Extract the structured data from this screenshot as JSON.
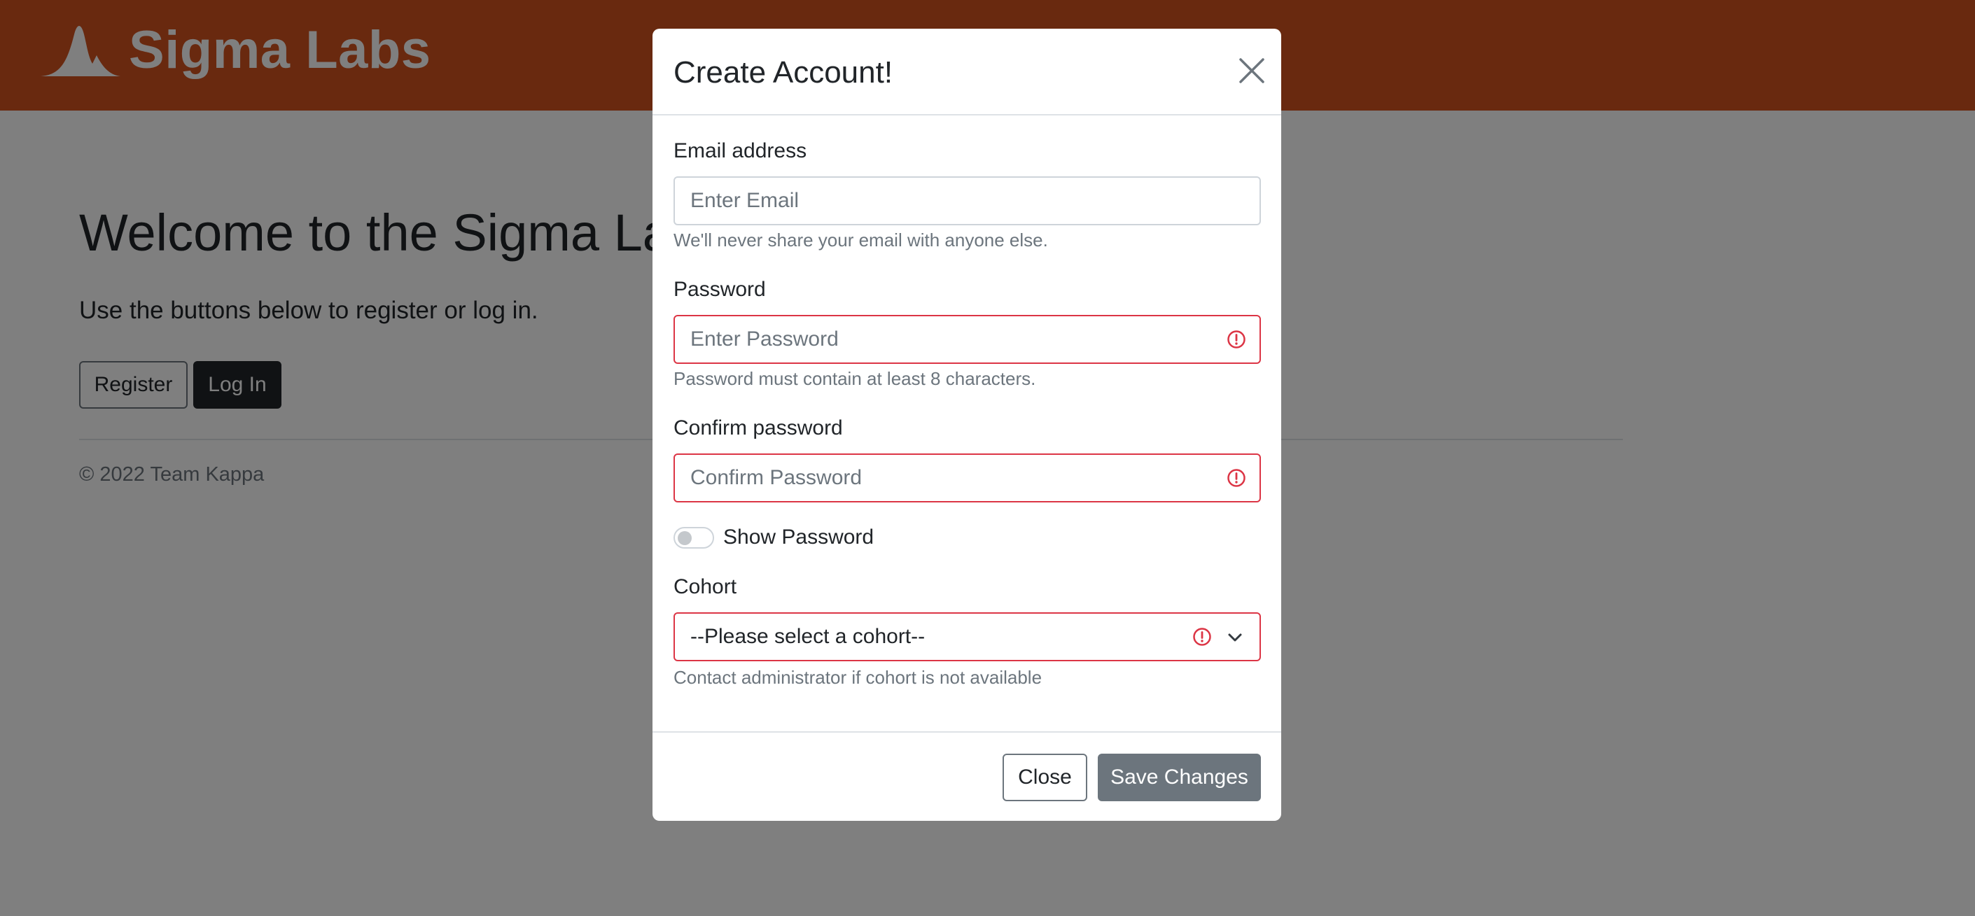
{
  "header": {
    "brand_name": "Sigma Labs",
    "brand_color": "#d2521f"
  },
  "main": {
    "title": "Welcome to the Sigma Labs Alumni List",
    "subtitle": "Use the buttons below to register or log in.",
    "register_label": "Register",
    "login_label": "Log In"
  },
  "footer": {
    "copyright": "© 2022 Team Kappa"
  },
  "modal": {
    "title": "Create Account!",
    "email": {
      "label": "Email address",
      "placeholder": "Enter Email",
      "value": "",
      "help": "We'll never share your email with anyone else."
    },
    "password": {
      "label": "Password",
      "placeholder": "Enter Password",
      "value": "",
      "help": "Password must contain at least 8 characters.",
      "state": "invalid"
    },
    "confirm_password": {
      "label": "Confirm password",
      "placeholder": "Confirm Password",
      "value": "",
      "state": "invalid"
    },
    "show_password": {
      "label": "Show Password",
      "checked": false
    },
    "cohort": {
      "label": "Cohort",
      "selected": "--Please select a cohort--",
      "help": "Contact administrator if cohort is not available",
      "state": "invalid"
    },
    "close_label": "Close",
    "save_label": "Save Changes"
  },
  "colors": {
    "invalid": "#dc3545",
    "secondary": "#6c757d",
    "dark": "#212529"
  },
  "icons": {
    "logo": "bell-curve-logo-icon",
    "close": "close-icon",
    "invalid": "exclamation-circle-icon",
    "dropdown": "chevron-down-icon"
  }
}
